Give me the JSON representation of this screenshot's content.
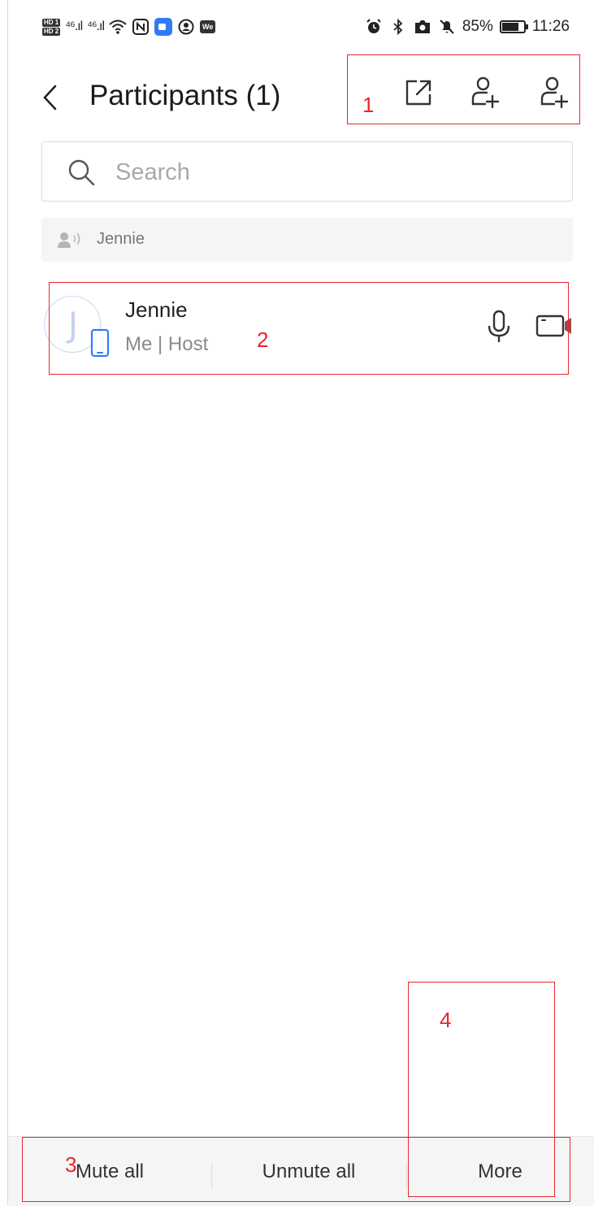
{
  "status_bar": {
    "hd1": "HD 1",
    "hd2": "HD 2",
    "signal1": "⁴⁶.ıl",
    "signal2": "⁴⁶.ıl",
    "battery_percent": "85%",
    "battery_level": 0.85,
    "time": "11:26",
    "we_badge": "We"
  },
  "header": {
    "title": "Participants (1)",
    "icons": [
      "back-icon",
      "share-icon",
      "add-participant-icon",
      "add-participant-icon"
    ]
  },
  "search": {
    "placeholder": "Search"
  },
  "speaking": {
    "name": "Jennie"
  },
  "participants": [
    {
      "avatar_letter": "J",
      "name": "Jennie",
      "role": "Me | Host"
    }
  ],
  "bottom_bar": {
    "mute_all": "Mute all",
    "unmute_all": "Unmute all",
    "more": "More"
  },
  "annotations": {
    "a1": "1",
    "a2": "2",
    "a3": "3",
    "a4": "4",
    "color": "#e8262b"
  },
  "colors": {
    "accent_blue": "#2f7cf6",
    "avatar_ring": "#c9d8f2",
    "text_secondary": "#8a8a8a"
  }
}
